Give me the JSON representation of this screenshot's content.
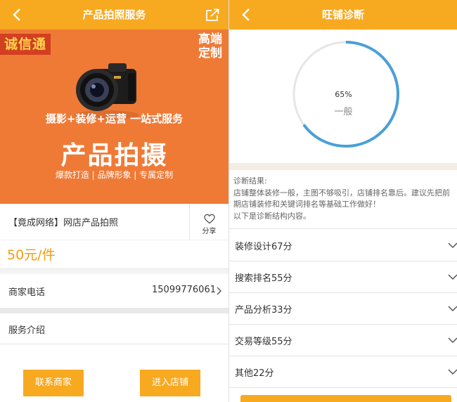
{
  "left": {
    "header": {
      "title": "产品拍照服务",
      "back_icon": "back-arrow-icon",
      "share_icon": "share-icon"
    },
    "banner": {
      "brand": "诚信通",
      "corner_line1": "高端",
      "corner_line2": "定制",
      "slogan": "摄影+装修+运营  一站式服务",
      "headline": "产品拍摄",
      "sub": "爆款打造 | 品牌形象 | 专属定制"
    },
    "product": {
      "name": "【竟成网络】网店产品拍照",
      "favorite_label": "分享",
      "price": "50元/件"
    },
    "phone": {
      "label": "商家电话",
      "number": "15099776061"
    },
    "service": {
      "label": "服务介绍"
    },
    "buttons": {
      "contact": "联系商家",
      "store": "进入店铺"
    }
  },
  "right": {
    "header": {
      "title": "旺铺诊断",
      "back_icon": "back-arrow-icon"
    },
    "score": {
      "percent": "65%",
      "progress": 0.65,
      "level": "一般"
    },
    "result": {
      "title": "诊断结果:",
      "text": "店铺整体装修一般，主图不够吸引，店铺排名靠后。建议先把前期店铺装修和关键词排名等基础工作做好！",
      "note": "以下是诊断结构内容。"
    },
    "items": [
      {
        "label": "装修设计67分"
      },
      {
        "label": "搜索排名55分"
      },
      {
        "label": "产品分析33分"
      },
      {
        "label": "交易等级55分"
      },
      {
        "label": "其他22分"
      }
    ]
  },
  "colors": {
    "accent": "#f7a920",
    "banner": "#ef7a36",
    "ring": "#4a9fd8",
    "price": "#f39c12"
  }
}
